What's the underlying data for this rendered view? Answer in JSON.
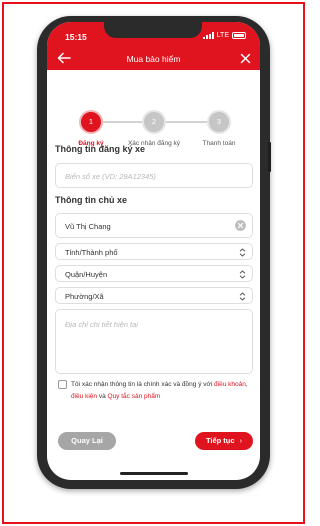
{
  "status_bar": {
    "time": "15:15",
    "network": "LTE"
  },
  "header": {
    "title": "Mua bảo hiểm"
  },
  "steps": [
    {
      "number": "1",
      "label": "Đăng ký"
    },
    {
      "number": "2",
      "label": "Xác nhận đăng ký"
    },
    {
      "number": "3",
      "label": "Thanh toán"
    }
  ],
  "active_step": 1,
  "vehicle_section": {
    "title": "Thông tin đăng ký xe",
    "plate_placeholder": "Biển số xe (VD: 29A12345)"
  },
  "owner_section": {
    "title": "Thông tin chủ xe",
    "name_value": "Vũ Thị Chang",
    "province_placeholder": "Tỉnh/Thành phố",
    "district_placeholder": "Quận/Huyện",
    "ward_placeholder": "Phường/Xã",
    "address_placeholder": "Địa chỉ chi tiết hiện tại"
  },
  "consent": {
    "text_1": "Tôi xác nhận thông tin là chính xác và đồng ý với ",
    "link_terms": "điều khoản",
    "sep_1": ", ",
    "link_conditions": "điều kiện",
    "sep_2": " và ",
    "link_rules": "Quy tắc sản phẩm",
    "checked": false
  },
  "buttons": {
    "back_label": "Quay Lại",
    "next_label": "Tiếp tục",
    "next_arrow": "›"
  },
  "colors": {
    "primary": "#e0141f",
    "disabled_button": "#a6a6a6",
    "frame_border": "#e8111a"
  },
  "icons": [
    "back-arrow-icon",
    "close-icon",
    "clear-icon",
    "chevron-up-down-icon",
    "chevron-right-icon"
  ]
}
